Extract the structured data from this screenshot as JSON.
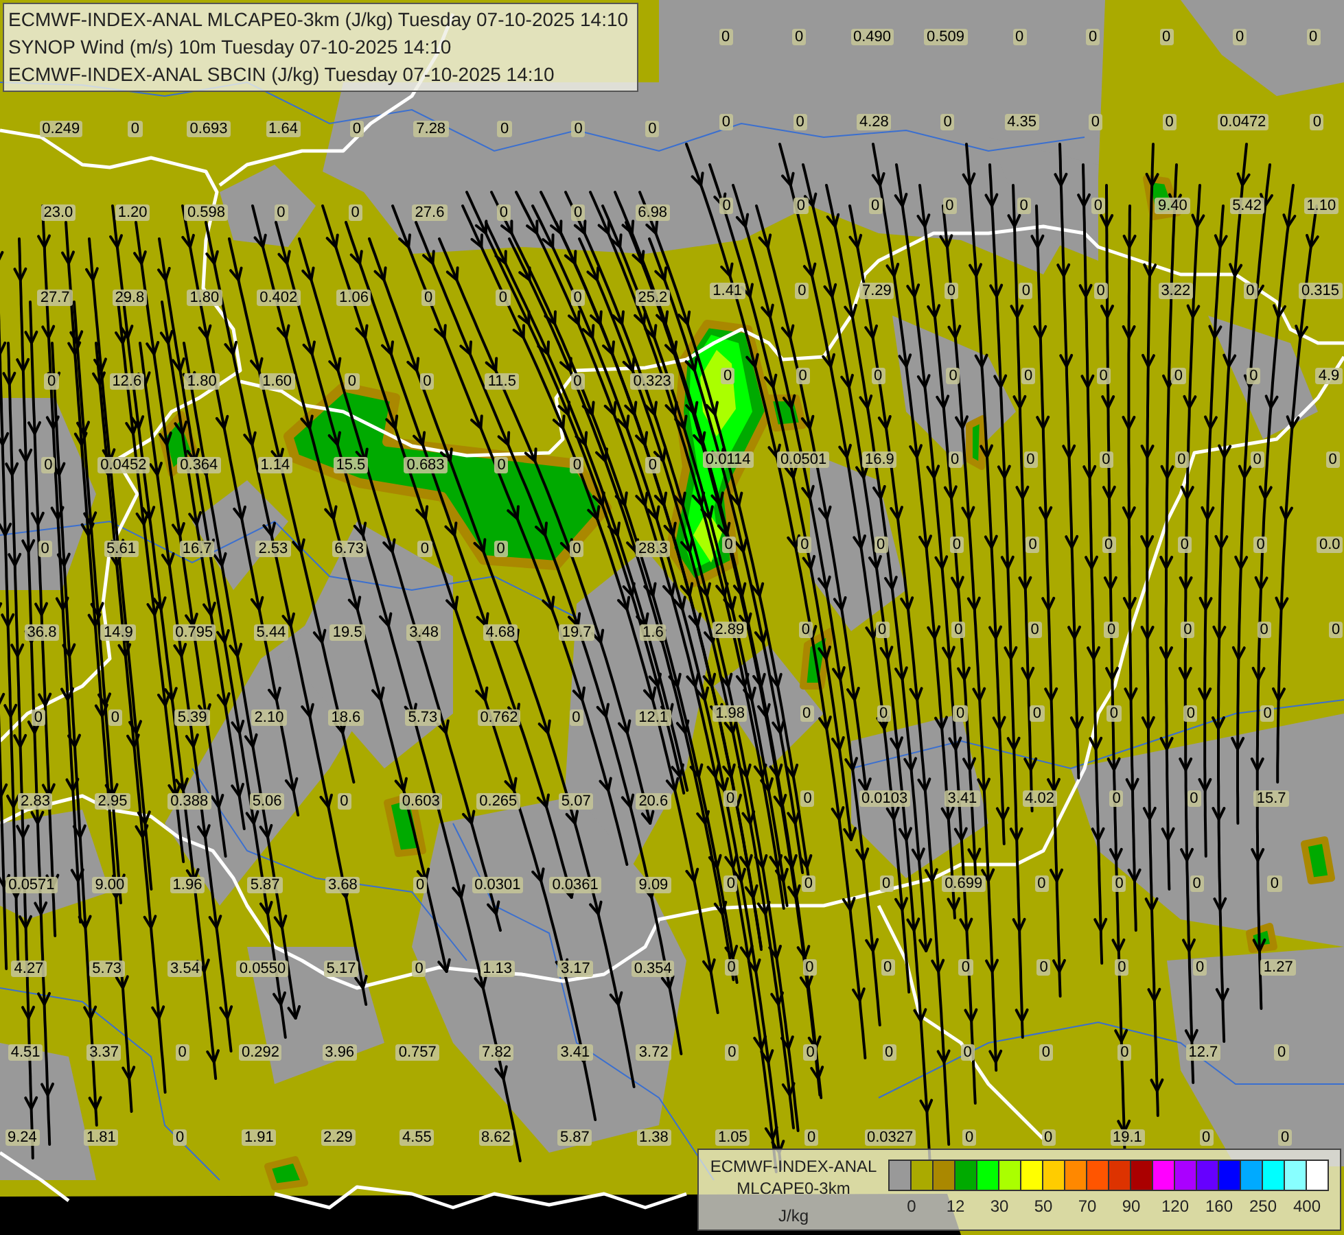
{
  "title_lines": [
    "ECMWF-INDEX-ANAL MLCAPE0-3km (J/kg) Tuesday 07-10-2025 14:10",
    "SYNOP Wind (m/s) 10m Tuesday 07-10-2025 14:10",
    "ECMWF-INDEX-ANAL SBCIN (J/kg) Tuesday 07-10-2025 14:10"
  ],
  "station_values": [
    {
      "values": [
        "0",
        "0",
        "0.490",
        "0.509",
        "0",
        "0",
        "0",
        "0",
        "0"
      ]
    },
    {
      "values": [
        "0.249",
        "0",
        "0.693",
        "1.64",
        "0",
        "7.28",
        "0",
        "0",
        "0",
        "0",
        "0",
        "4.28",
        "0",
        "4.35",
        "0",
        "0",
        "0.0472",
        "0"
      ]
    },
    {
      "values": [
        "23.0",
        "1.20",
        "0.598",
        "0",
        "0",
        "27.6",
        "0",
        "0",
        "6.98",
        "0",
        "0",
        "0",
        "0",
        "0",
        "0",
        "9.40",
        "5.42",
        "1.10"
      ]
    },
    {
      "values": [
        "27.7",
        "29.8",
        "1.80",
        "0.402",
        "1.06",
        "0",
        "0",
        "0",
        "25.2",
        "1.41",
        "0",
        "7.29",
        "0",
        "0",
        "0",
        "3.22",
        "0",
        "0.315"
      ]
    },
    {
      "values": [
        "0",
        "12.6",
        "1.80",
        "1.60",
        "0",
        "0",
        "11.5",
        "0",
        "0.323",
        "0",
        "0",
        "0",
        "0",
        "0",
        "0",
        "0",
        "0",
        "4.9"
      ]
    },
    {
      "values": [
        "0",
        "0.0452",
        "0.364",
        "1.14",
        "15.5",
        "0.683",
        "0",
        "0",
        "0",
        "0.0114",
        "0.0501",
        "16.9",
        "0",
        "0",
        "0",
        "0",
        "0",
        "0"
      ]
    },
    {
      "values": [
        "0",
        "5.61",
        "16.7",
        "2.53",
        "6.73",
        "0",
        "0",
        "0",
        "28.3",
        "0",
        "0",
        "0",
        "0",
        "0",
        "0",
        "0",
        "0",
        "0.0"
      ]
    },
    {
      "values": [
        "36.8",
        "14.9",
        "0.795",
        "5.44",
        "19.5",
        "3.48",
        "4.68",
        "19.7",
        "1.6",
        "2.89",
        "0",
        "0",
        "0",
        "0",
        "0",
        "0",
        "0",
        "0"
      ]
    },
    {
      "values": [
        "0",
        "0",
        "5.39",
        "2.10",
        "18.6",
        "5.73",
        "0.762",
        "0",
        "12.1",
        "1.98",
        "0",
        "0",
        "0",
        "0",
        "0",
        "0",
        "0"
      ]
    },
    {
      "values": [
        "2.83",
        "2.95",
        "0.388",
        "5.06",
        "0",
        "0.603",
        "0.265",
        "5.07",
        "20.6",
        "0",
        "0",
        "0.0103",
        "3.41",
        "4.02",
        "0",
        "0",
        "15.7"
      ]
    },
    {
      "values": [
        "0.0571",
        "9.00",
        "1.96",
        "5.87",
        "3.68",
        "0",
        "0.0301",
        "0.0361",
        "9.09",
        "0",
        "0",
        "0",
        "0.699",
        "0",
        "0",
        "0",
        "0"
      ]
    },
    {
      "values": [
        "4.27",
        "5.73",
        "3.54",
        "0.0550",
        "5.17",
        "0",
        "1.13",
        "3.17",
        "0.354",
        "0",
        "0",
        "0",
        "0",
        "0",
        "0",
        "0",
        "1.27"
      ]
    },
    {
      "values": [
        "4.51",
        "3.37",
        "0",
        "0.292",
        "3.96",
        "0.757",
        "7.82",
        "3.41",
        "3.72",
        "0",
        "0",
        "0",
        "0",
        "0",
        "0",
        "12.7",
        "0"
      ]
    },
    {
      "values": [
        "9.24",
        "1.81",
        "0",
        "1.91",
        "2.29",
        "4.55",
        "8.62",
        "5.87",
        "1.38",
        "1.05",
        "0",
        "0.0327",
        "0",
        "0",
        "19.1",
        "0",
        "0"
      ]
    }
  ],
  "legend": {
    "title_lines": [
      "ECMWF-INDEX-ANAL",
      "MLCAPE0-3km"
    ],
    "unit": "J/kg",
    "swatches": [
      {
        "color": "#999999"
      },
      {
        "color": "#aaaa00"
      },
      {
        "color": "#aa8800"
      },
      {
        "color": "#00aa00"
      },
      {
        "color": "#00ff00"
      },
      {
        "color": "#aaff00"
      },
      {
        "color": "#ffff00"
      },
      {
        "color": "#ffcc00"
      },
      {
        "color": "#ff8800"
      },
      {
        "color": "#ff5500"
      },
      {
        "color": "#dd3300"
      },
      {
        "color": "#aa0000"
      },
      {
        "color": "#ff00ff"
      },
      {
        "color": "#aa00ff"
      },
      {
        "color": "#6600ff"
      },
      {
        "color": "#0000ff"
      },
      {
        "color": "#00aaff"
      },
      {
        "color": "#00ffff"
      },
      {
        "color": "#88ffff"
      },
      {
        "color": "#ffffff"
      }
    ],
    "ticks": [
      "0",
      "12",
      "30",
      "50",
      "70",
      "90",
      "120",
      "160",
      "250",
      "400"
    ]
  }
}
